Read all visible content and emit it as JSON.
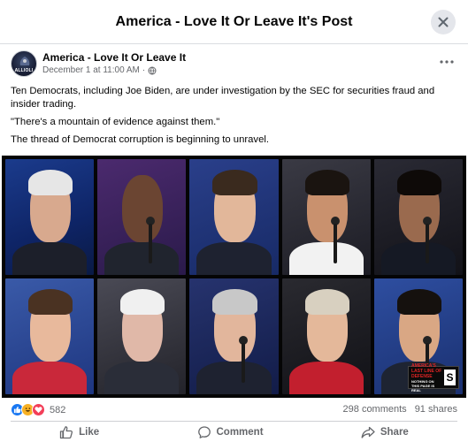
{
  "dialog": {
    "title": "America - Love It Or Leave It's Post"
  },
  "post": {
    "page_name": "America - Love It Or Leave It",
    "avatar_text": "ALLIOLI",
    "timestamp": "December 1 at 11:00 AM",
    "separator": "·",
    "audience_icon": "globe-icon",
    "paragraphs": [
      "Ten Democrats, including Joe Biden, are under investigation by the SEC for securities fraud and insider trading.",
      "\"There's a mountain of evidence against them.\"",
      "The thread of Democrat corruption is beginning to unravel."
    ],
    "image": {
      "badge_text": "AMERICA'S LAST LINE OF DEFENSE",
      "badge_subtext": "NOTHING ON THIS PAGE IS REAL",
      "badge_letter": "S"
    }
  },
  "stats": {
    "reaction_icons": [
      "like-icon",
      "haha-icon",
      "love-icon"
    ],
    "reaction_count": "582",
    "comments": "298 comments",
    "shares": "91 shares"
  },
  "actions": {
    "like": "Like",
    "comment": "Comment",
    "share": "Share"
  },
  "colors": {
    "like_blue": "#1877f2",
    "haha_yellow": "#f7b125",
    "love_red": "#f33e58",
    "muted_text": "#65676b"
  }
}
